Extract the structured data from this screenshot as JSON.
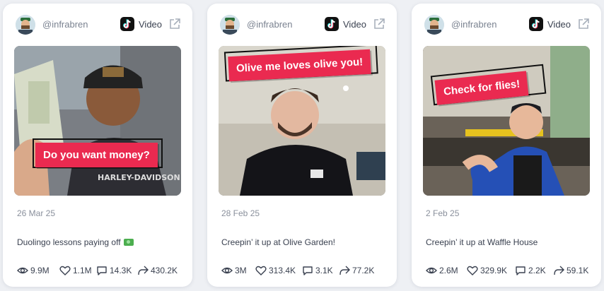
{
  "cards": [
    {
      "handle": "@infrabren",
      "platform_label": "Video",
      "platform_icon": "tiktok-icon",
      "caption_overlay": "Do you want money?",
      "date": "26 Mar 25",
      "title": "Duolingo lessons paying off",
      "title_emoji": "money-emoji",
      "views": "9.9M",
      "likes": "1.1M",
      "comments": "14.3K",
      "shares": "430.2K"
    },
    {
      "handle": "@infrabren",
      "platform_label": "Video",
      "platform_icon": "tiktok-icon",
      "caption_overlay": "Olive me loves olive you!",
      "date": "28 Feb 25",
      "title": "Creepin’ it up at Olive Garden!",
      "views": "3M",
      "likes": "313.4K",
      "comments": "3.1K",
      "shares": "77.2K"
    },
    {
      "handle": "@infrabren",
      "platform_label": "Video",
      "platform_icon": "tiktok-icon",
      "caption_overlay": "Check for flies!",
      "date": "2 Feb 25",
      "title": "Creepin’ it up at Waffle House",
      "views": "2.6M",
      "likes": "329.9K",
      "comments": "2.2K",
      "shares": "59.1K"
    }
  ],
  "colors": {
    "caption_bg": "#ea2a50",
    "card_bg": "#ffffff",
    "page_bg": "#eef0f4",
    "muted_text": "#8a909c"
  }
}
